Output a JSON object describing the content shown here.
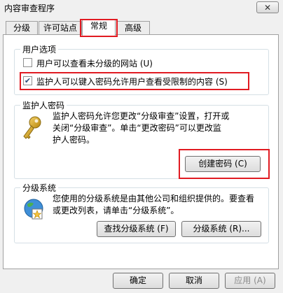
{
  "window": {
    "title": "内容审查程序",
    "close": "✕"
  },
  "tabs": [
    "分级",
    "许可站点",
    "常规",
    "高级"
  ],
  "user_options": {
    "label": "用户选项",
    "opt1": "用户可以查看未分级的网站 (U)",
    "opt2": "监护人可以键入密码允许用户查看受限制的内容 (S)",
    "opt1_checked": false,
    "opt2_checked": true
  },
  "supervisor": {
    "label": "监护人密码",
    "line1": "监护人密码允许您更改“分级审查”设置，打开或",
    "line2": "关闭“分级审查”。单击“更改密码”可以更改监",
    "line3": "护人密码。",
    "create_button": "创建密码 (C)"
  },
  "rating_systems": {
    "label": "分级系统",
    "line1": "您使用的分级系统是由其他公司和组织提供的。要查看",
    "line2": "或更改列表，请单击“分级系统”。",
    "find_button": "查找分级系统 (F)",
    "systems_button": "分级系统 (R)..."
  },
  "footer": {
    "ok": "确定",
    "cancel": "取消",
    "apply": "应用 (A)"
  },
  "colors": {
    "highlight": "#e11b22"
  }
}
